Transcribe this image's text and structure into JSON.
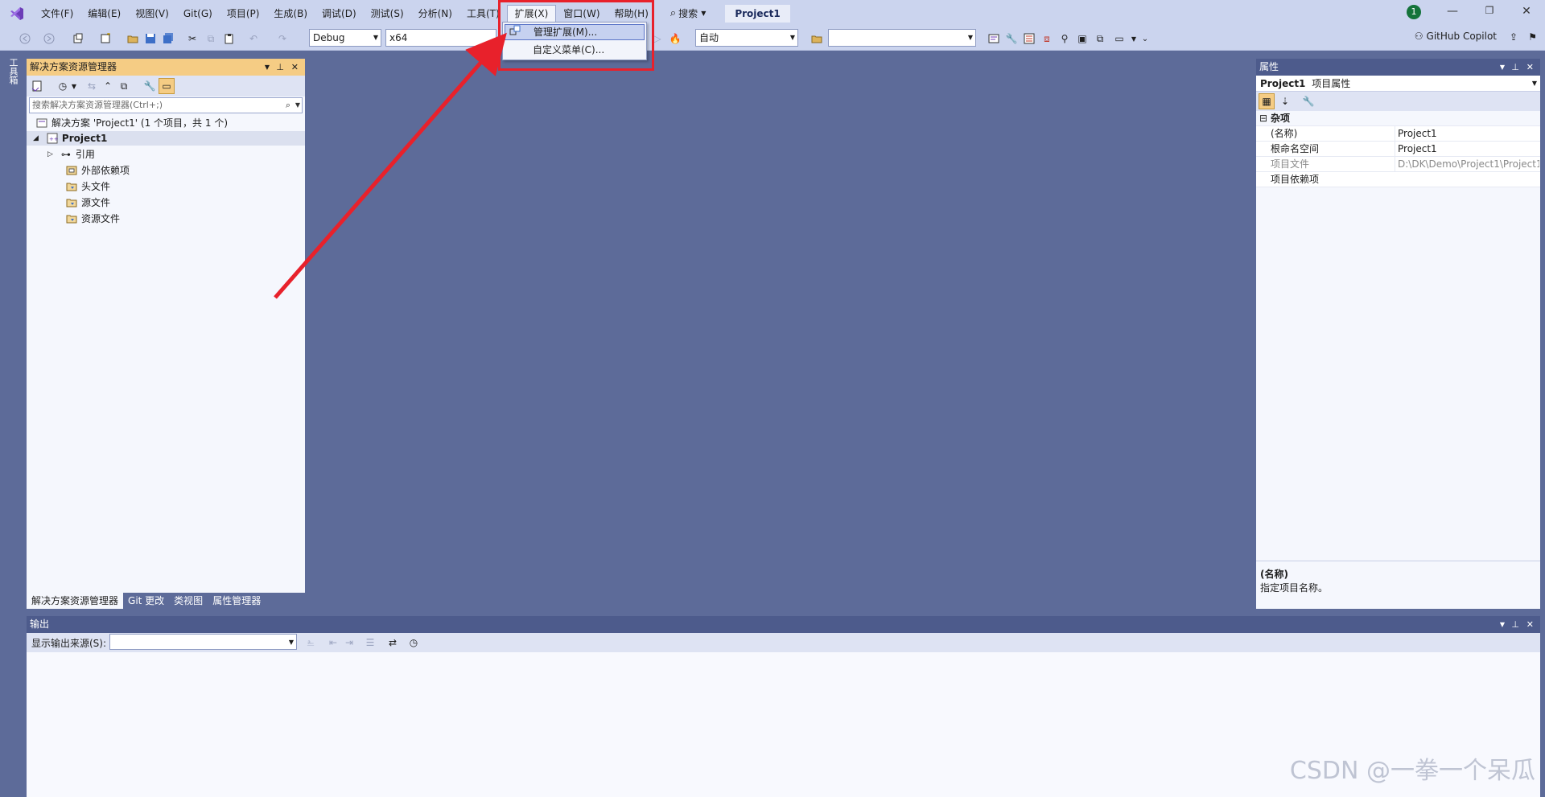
{
  "menu": {
    "items": [
      "文件(F)",
      "编辑(E)",
      "视图(V)",
      "Git(G)",
      "项目(P)",
      "生成(B)",
      "调试(D)",
      "测试(S)",
      "分析(N)",
      "工具(T)",
      "扩展(X)",
      "窗口(W)",
      "帮助(H)"
    ],
    "active_index": 10,
    "search_label": "搜索",
    "project_title": "Project1",
    "notification_count": "1"
  },
  "extensions_menu": {
    "items": [
      "管理扩展(M)...",
      "自定义菜单(C)..."
    ]
  },
  "toolbar": {
    "config_value": "Debug",
    "platform_value": "x64",
    "run_mode_value": "自动",
    "copilot_label": "GitHub Copilot"
  },
  "toolbox": {
    "label": "工具箱"
  },
  "solution_explorer": {
    "title": "解决方案资源管理器",
    "search_placeholder": "搜索解决方案资源管理器(Ctrl+;)",
    "solution_label": "解决方案 'Project1' (1 个项目，共 1 个)",
    "project_label": "Project1",
    "nodes": [
      "引用",
      "外部依赖项",
      "头文件",
      "源文件",
      "资源文件"
    ],
    "tabs": [
      "解决方案资源管理器",
      "Git 更改",
      "类视图",
      "属性管理器"
    ]
  },
  "properties": {
    "title": "属性",
    "object_name": "Project1",
    "object_type": "项目属性",
    "category": "杂项",
    "rows": [
      {
        "key": "(名称)",
        "value": "Project1"
      },
      {
        "key": "根命名空间",
        "value": "Project1"
      },
      {
        "key": "项目文件",
        "value": "D:\\DK\\Demo\\Project1\\Project1"
      },
      {
        "key": "项目依赖项",
        "value": ""
      }
    ],
    "desc_title": "(名称)",
    "desc_text": "指定项目名称。"
  },
  "output": {
    "title": "输出",
    "source_label": "显示输出来源(S):"
  },
  "watermark": "CSDN @一拳一个呆瓜",
  "colors": {
    "accent": "#f5cc84",
    "highlight_box": "#e8212b",
    "arrow": "#e8212b",
    "titlebar": "#cbd4ee"
  }
}
